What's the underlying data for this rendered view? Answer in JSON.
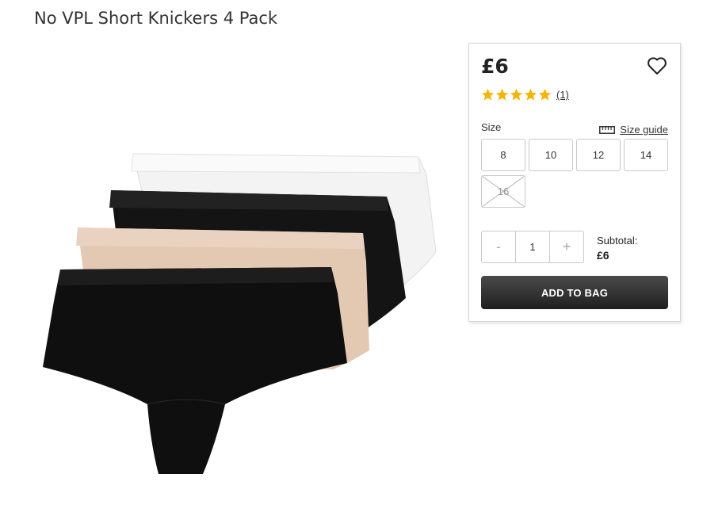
{
  "product": {
    "title": "No VPL Short Knickers 4 Pack",
    "price": "£6",
    "rating": {
      "stars": 5,
      "review_count": "(1)"
    },
    "image_icon": "knickers-4-pack-image",
    "colors": {
      "white": "#f4f4f4",
      "black": "#111111",
      "nude": "#e3c8b2"
    }
  },
  "size_section": {
    "label": "Size",
    "guide_label": "Size guide",
    "sizes": [
      {
        "label": "8",
        "available": true
      },
      {
        "label": "10",
        "available": true
      },
      {
        "label": "12",
        "available": true
      },
      {
        "label": "14",
        "available": true
      },
      {
        "label": "16",
        "available": false
      }
    ]
  },
  "quantity": {
    "minus": "-",
    "value": "1",
    "plus": "+"
  },
  "subtotal": {
    "label": "Subtotal:",
    "value": "£6"
  },
  "cta": {
    "add_to_bag": "ADD TO BAG",
    "color": "#2b2b2b"
  },
  "icons": {
    "wishlist": "heart-icon",
    "star": "star-icon",
    "ruler": "ruler-icon"
  },
  "accent": {
    "star": "#f5b400"
  }
}
